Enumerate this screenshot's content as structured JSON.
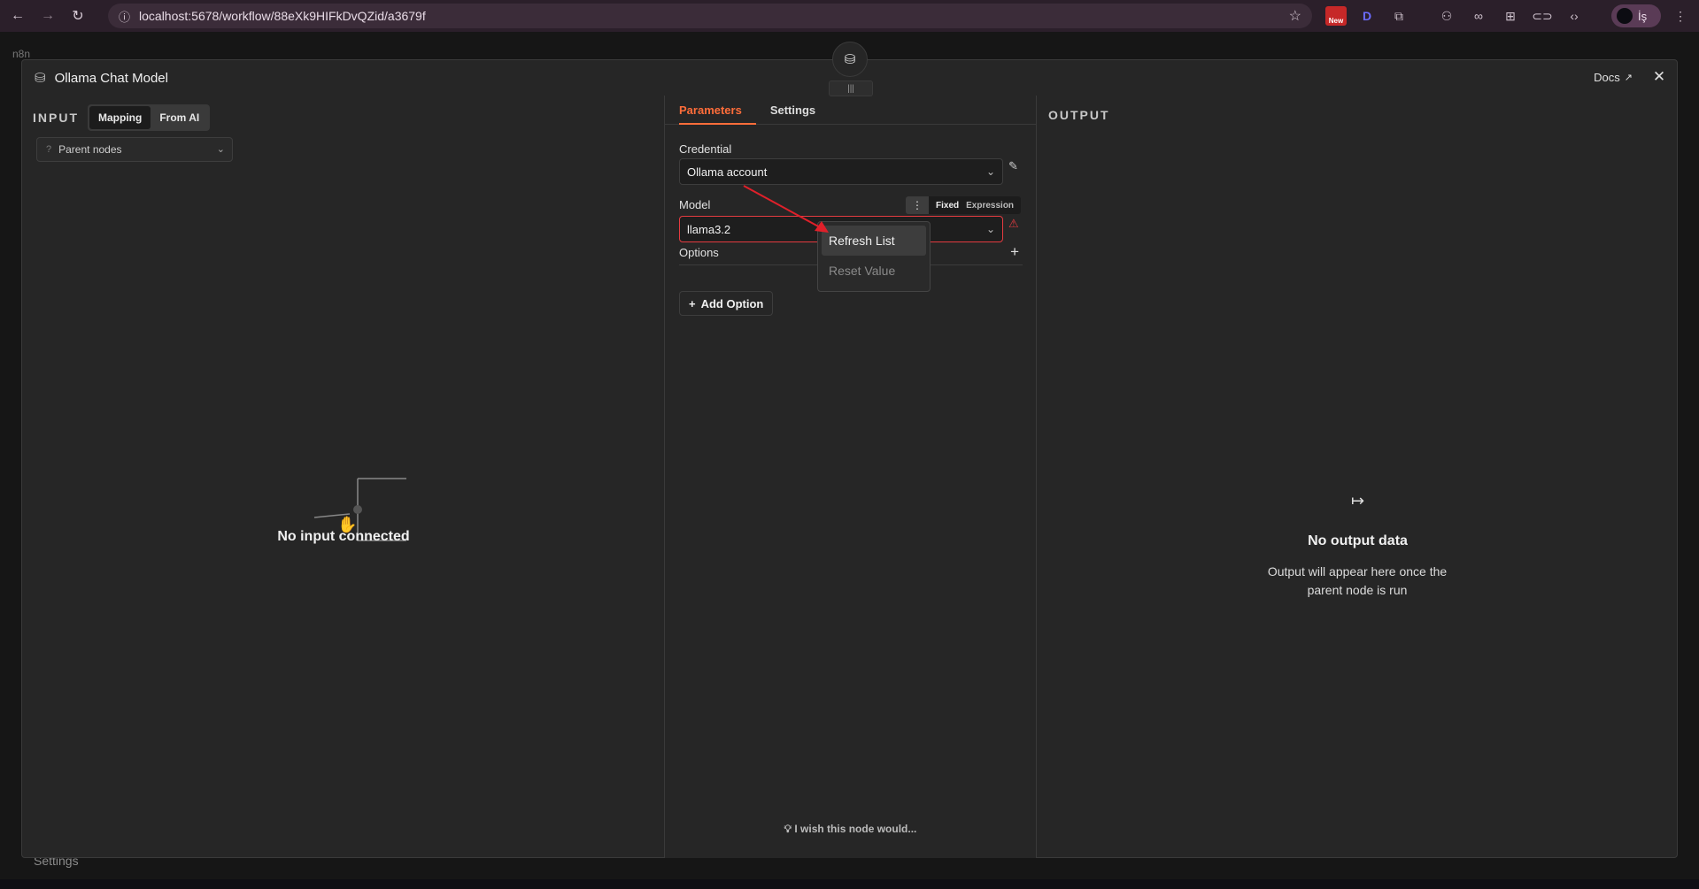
{
  "browser": {
    "url": "localhost:5678/workflow/88eXk9HIFkDvQZid/a3679f",
    "new_badge": "New",
    "profile_label": "İş"
  },
  "background": {
    "logo_text": "n8n",
    "sidebar_settings": "Settings"
  },
  "modal": {
    "title": "Ollama Chat Model",
    "docs_label": "Docs",
    "input_pane": {
      "label": "INPUT",
      "modes": [
        "Mapping",
        "From AI"
      ],
      "parent_select": "Parent nodes",
      "empty_text": "No input connected"
    },
    "params_pane": {
      "tabs": [
        "Parameters",
        "Settings"
      ],
      "credential_label": "Credential",
      "credential_value": "Ollama account",
      "model_label": "Model",
      "model_value": "llama3.2",
      "mode_fixed": "Fixed",
      "mode_expression": "Expression",
      "options_label": "Options",
      "add_option_label": "Add Option",
      "wish_text": "I wish this node would..."
    },
    "dropdown": {
      "items": [
        "Refresh List",
        "Reset Value"
      ]
    },
    "output_pane": {
      "label": "OUTPUT",
      "empty_title": "No output data",
      "empty_sub": "Output will appear here once the parent node is run"
    }
  },
  "colors": {
    "accent": "#ff6d3a",
    "error": "#e43b40",
    "annotation_arrow": "#e0202a"
  }
}
